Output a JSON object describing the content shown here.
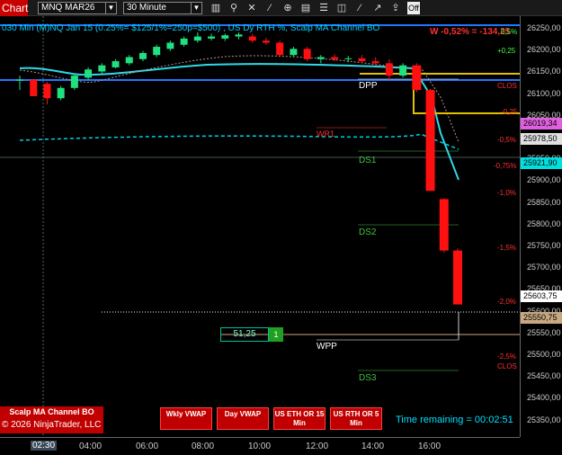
{
  "toolbar": {
    "title": "Chart",
    "instrument": "MNQ MAR26",
    "interval": "30 Minute",
    "off_label": "Off",
    "icons": [
      "bar-chart-icon",
      "magnifier-icon",
      "crosshair-icon",
      "draw-line-icon",
      "properties-icon",
      "templates-icon",
      "strategies-icon",
      "indicators-icon",
      "data-box-icon",
      "trending-icon",
      "share-icon",
      "tools-icon"
    ]
  },
  "header": {
    "title": "030 Min (M)NQ Jan 15 (0.25%= $125/1%=250p=$500) , US Dy RTH %, Scalp MA Channel BO",
    "pnl": "W -0,52% = -134,25"
  },
  "chart_data": {
    "type": "candlestick",
    "ylim": [
      25330,
      26300
    ],
    "x_labels": [
      "02:30",
      "04:00",
      "06:00",
      "08:00",
      "10:00",
      "12:00",
      "14:00",
      "16:00"
    ],
    "y_ticks": [
      "26250,00",
      "26200,00",
      "26150,00",
      "26100,00",
      "26050,00",
      "26000,00",
      "25950,00",
      "25900,00",
      "25850,00",
      "25800,00",
      "25750,00",
      "25700,00",
      "25650,00",
      "25600,00",
      "25550,00",
      "25500,00",
      "25450,00",
      "25400,00",
      "25350,00"
    ],
    "price_tags": [
      {
        "label": "26019,34",
        "bg": "#e060e0",
        "fg": "#000"
      },
      {
        "label": "25978,50",
        "bg": "#e0e0e0",
        "fg": "#000"
      },
      {
        "label": "25921,90",
        "bg": "#00e0e0",
        "fg": "#000"
      },
      {
        "label": "25603,75",
        "bg": "#ffffff",
        "fg": "#000"
      },
      {
        "label": "25550,75",
        "bg": "#c8a880",
        "fg": "#000"
      }
    ],
    "pct_labels": [
      {
        "label": "0,5%",
        "color": "#40ff40"
      },
      {
        "label": "+0,25",
        "color": "#40ff40"
      },
      {
        "label": "CLOS",
        "color": "#ff3030"
      },
      {
        "label": "-0,25",
        "color": "#ff3030"
      },
      {
        "label": "-0,5%",
        "color": "#ff3030"
      },
      {
        "label": "-0,75%",
        "color": "#ff3030"
      },
      {
        "label": "-1,0%",
        "color": "#ff3030"
      },
      {
        "label": "-1,5%",
        "color": "#ff3030"
      },
      {
        "label": "-2,0%",
        "color": "#ff3030"
      },
      {
        "label": "-2,5%",
        "color": "#ff3030"
      },
      {
        "label": "CLOS",
        "color": "#ff3030"
      }
    ],
    "levels": [
      {
        "label": "DPP",
        "color": "#ffffff"
      },
      {
        "label": "WR1",
        "color": "#ff3030"
      },
      {
        "label": "DS1",
        "color": "#40c040"
      },
      {
        "label": "DS2",
        "color": "#40c040"
      },
      {
        "label": "WPP",
        "color": "#ffffff"
      },
      {
        "label": "DS3",
        "color": "#40c040"
      }
    ],
    "candles": [
      [
        26150,
        26160,
        26125,
        26150
      ],
      [
        26150,
        26152,
        26110,
        26110
      ],
      [
        26140,
        26145,
        26090,
        26105
      ],
      [
        26105,
        26135,
        26100,
        26130
      ],
      [
        26130,
        26165,
        26125,
        26160
      ],
      [
        26155,
        26180,
        26150,
        26175
      ],
      [
        26170,
        26190,
        26165,
        26185
      ],
      [
        26180,
        26200,
        26178,
        26195
      ],
      [
        26190,
        26210,
        26185,
        26205
      ],
      [
        26200,
        26220,
        26195,
        26215
      ],
      [
        26210,
        26235,
        26205,
        26230
      ],
      [
        26225,
        26245,
        26220,
        26240
      ],
      [
        26235,
        26255,
        26230,
        26250
      ],
      [
        26245,
        26265,
        26240,
        26255
      ],
      [
        26250,
        26262,
        26245,
        26255
      ],
      [
        26250,
        26262,
        26244,
        26258
      ],
      [
        26255,
        26265,
        26248,
        26260
      ],
      [
        26255,
        26262,
        26240,
        26245
      ],
      [
        26245,
        26252,
        26235,
        26240
      ],
      [
        26240,
        26245,
        26205,
        26210
      ],
      [
        26210,
        26230,
        26205,
        26225
      ],
      [
        26225,
        26230,
        26195,
        26200
      ],
      [
        26200,
        26210,
        26190,
        26205
      ],
      [
        26205,
        26212,
        26195,
        26200
      ],
      [
        26200,
        26208,
        26192,
        26202
      ],
      [
        26202,
        26210,
        26190,
        26195
      ],
      [
        26195,
        26205,
        26185,
        26190
      ],
      [
        26190,
        26200,
        26150,
        26160
      ],
      [
        26160,
        26190,
        26155,
        26185
      ],
      [
        26185,
        26190,
        26120,
        26125
      ],
      [
        26125,
        26128,
        25880,
        25880
      ],
      [
        25860,
        25862,
        25730,
        25735
      ],
      [
        25735,
        25740,
        25604,
        25604
      ]
    ]
  },
  "order": {
    "price": "51,25",
    "qty": "1"
  },
  "buttons": {
    "wkly_vwap": "Wkly VWAP",
    "day_vwap": "Day VWAP",
    "us_eth": "US ETH OR 15 Min",
    "us_rth": "US RTH OR 5 Min"
  },
  "footer": {
    "strategy": "Scalp MA Channel BO",
    "copyright": "© 2026 NinjaTrader, LLC",
    "time_remaining": "Time remaining = 00:02:51"
  }
}
